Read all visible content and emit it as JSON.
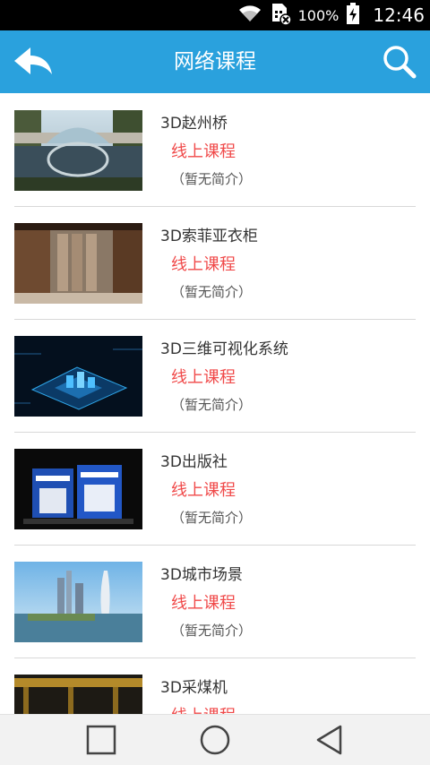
{
  "status_bar": {
    "battery_percent": "100%",
    "time": "12:46",
    "icons": [
      "wifi-icon",
      "sim-off-icon",
      "battery-charging-icon"
    ]
  },
  "header": {
    "title": "网络课程",
    "back_icon": "back-arrow-icon",
    "search_icon": "search-icon",
    "background_color": "#2aa1dd"
  },
  "courses": [
    {
      "name": "3D赵州桥",
      "type": "线上课程",
      "intro": "（暂无简介）",
      "thumb": "stone-arch-bridge-photo"
    },
    {
      "name": "3D索菲亚衣柜",
      "type": "线上课程",
      "intro": "（暂无简介）",
      "thumb": "wardrobe-room-render"
    },
    {
      "name": "3D三维可视化系统",
      "type": "线上课程",
      "intro": "（暂无简介）",
      "thumb": "blue-3d-visualization-city"
    },
    {
      "name": "3D出版社",
      "type": "线上课程",
      "intro": "（暂无简介）",
      "thumb": "exhibition-booth-render"
    },
    {
      "name": "3D城市场景",
      "type": "线上课程",
      "intro": "（暂无简介）",
      "thumb": "city-skyline-render"
    },
    {
      "name": "3D采煤机",
      "type": "线上课程",
      "intro": "",
      "thumb": "coal-mining-machine-render"
    }
  ],
  "colors": {
    "accent": "#2aa1dd",
    "course_type": "#f04a4a",
    "divider": "#d8d8d8"
  },
  "nav_bar": {
    "icons": [
      "recent-apps-icon",
      "home-icon",
      "back-triangle-icon"
    ]
  }
}
